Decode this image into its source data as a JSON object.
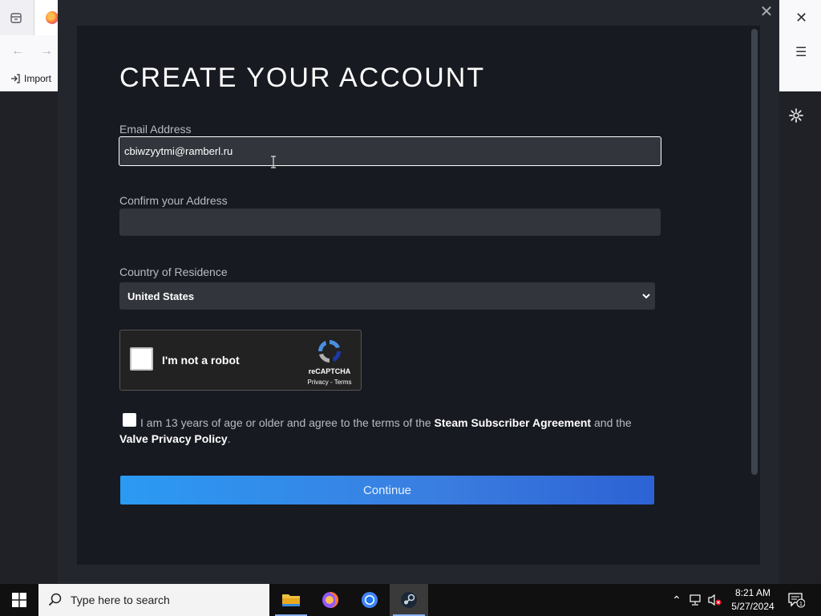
{
  "browser": {
    "bookmark_import": "Import"
  },
  "dialog": {
    "title": "CREATE YOUR ACCOUNT",
    "email_label": "Email Address",
    "email_value": "cbiwzyytmi@ramberl.ru",
    "confirm_label": "Confirm your Address",
    "confirm_value": "",
    "country_label": "Country of Residence",
    "country_value": "United States",
    "recaptcha": {
      "label": "I'm not a robot",
      "brand": "reCAPTCHA",
      "links": "Privacy - Terms"
    },
    "agreement": {
      "prefix": "I am 13 years of age or older and agree to the terms of the",
      "link1": "Steam Subscriber Agreement",
      "middle": "and the",
      "link2": "Valve Privacy Policy",
      "suffix": "."
    },
    "continue_label": "Continue"
  },
  "taskbar": {
    "search_placeholder": "Type here to search",
    "time": "8:21 AM",
    "date": "5/27/2024",
    "notification_count": "1"
  },
  "colors": {
    "accent_start": "#2b9af3",
    "accent_end": "#2d62d4",
    "dialog_bg": "#181a21",
    "field_bg": "#32353c"
  }
}
